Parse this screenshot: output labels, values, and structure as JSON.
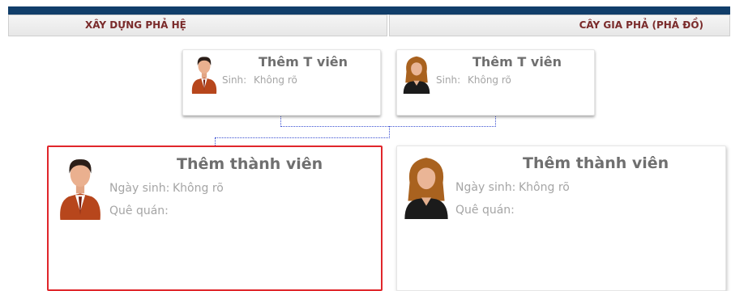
{
  "tabs": {
    "build": "XÂY DỰNG PHẢ HỆ",
    "tree": "CÂY GIA PHẢ (PHẢ ĐỒ)"
  },
  "parents": [
    {
      "name": "Thêm T viên",
      "birth_label": "Sinh:",
      "birth_value": "Không rõ",
      "gender": "male"
    },
    {
      "name": "Thêm T viên",
      "birth_label": "Sinh:",
      "birth_value": "Không rõ",
      "gender": "female"
    }
  ],
  "members": [
    {
      "name": "Thêm thành viên",
      "birth_label": "Ngày sinh:",
      "birth_value": "Không rõ",
      "hometown_label": "Quê quán:",
      "gender": "male",
      "selected": true
    },
    {
      "name": "Thêm thành viên",
      "birth_label": "Ngày sinh:",
      "birth_value": "Không rõ",
      "hometown_label": "Quê quán:",
      "gender": "female",
      "selected": false
    }
  ],
  "colors": {
    "top_bar": "#113e6a",
    "tab_text": "#7a2b2b",
    "selected_border": "#e0262b",
    "connector": "#3a4fd1"
  }
}
